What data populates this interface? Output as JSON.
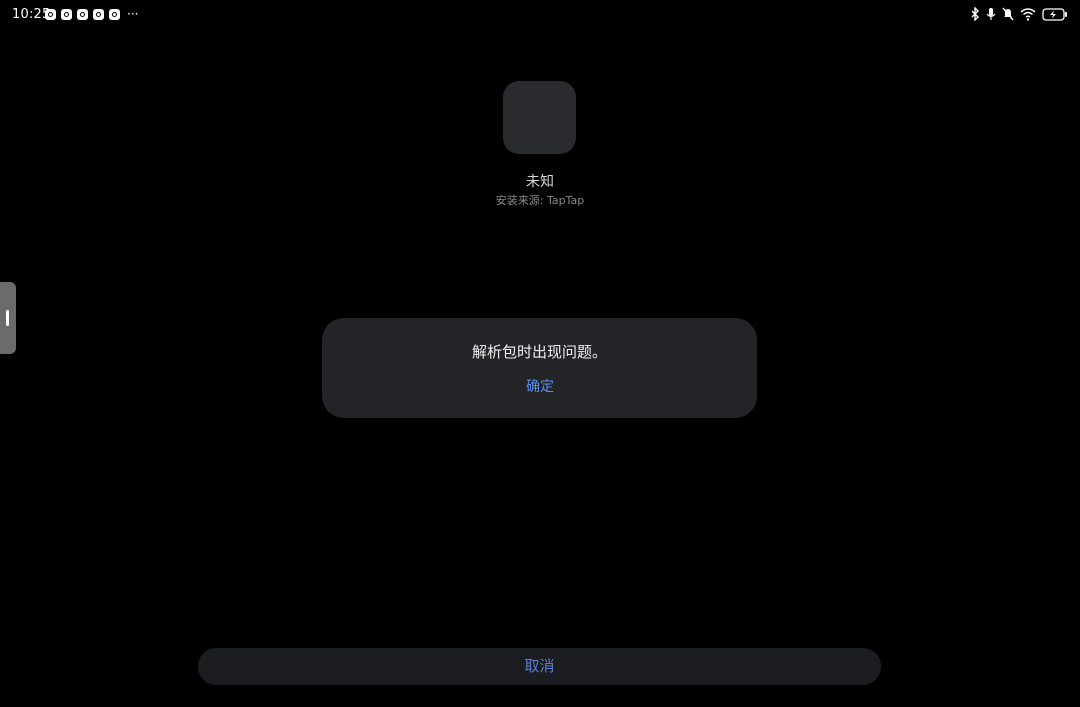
{
  "status_bar": {
    "time": "10:25",
    "more": "···",
    "notification_icons": [
      "app-notification-icon",
      "app-notification-icon",
      "app-notification-icon",
      "app-notification-icon",
      "app-notification-icon"
    ],
    "system_icons": [
      "bluetooth-icon",
      "microphone-icon",
      "mute-icon",
      "wifi-icon",
      "battery-charging-icon"
    ]
  },
  "app": {
    "name": "未知",
    "install_source": "安装来源: TapTap"
  },
  "dialog": {
    "message": "解析包时出现问题。",
    "confirm_label": "确定"
  },
  "footer": {
    "cancel_label": "取消"
  },
  "colors": {
    "background": "#000000",
    "dialog": "#232427",
    "accent": "#5b8ef0"
  }
}
